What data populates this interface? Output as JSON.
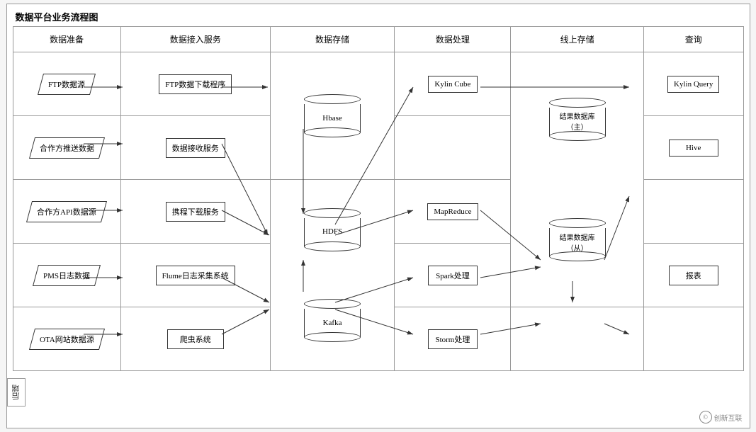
{
  "title": "数据平台业务流程图",
  "headers": [
    "数据准备",
    "数据接入服务",
    "数据存储",
    "数据处理",
    "线上存储",
    "查询"
  ],
  "nodes": {
    "sources": [
      "FTP数据源",
      "合作方推送数据",
      "合作方API数据源",
      "PMS日志数据",
      "OTA网站数据源"
    ],
    "ingest": [
      "FTP数据下载程序",
      "数据接收服务",
      "携程下载服务",
      "Flume日志采集系统",
      "爬虫系统"
    ],
    "storage": [
      "Hbase",
      "HDFS",
      "Kafka"
    ],
    "processing": [
      "Kylin Cube",
      "MapReduce",
      "Spark处理",
      "Storm处理"
    ],
    "online": [
      "结果数据库（主）",
      "结果数据库（从）"
    ],
    "query": [
      "Kylin Query",
      "Hive",
      "报表"
    ]
  },
  "side_label": "后端",
  "watermark": "创新互联"
}
